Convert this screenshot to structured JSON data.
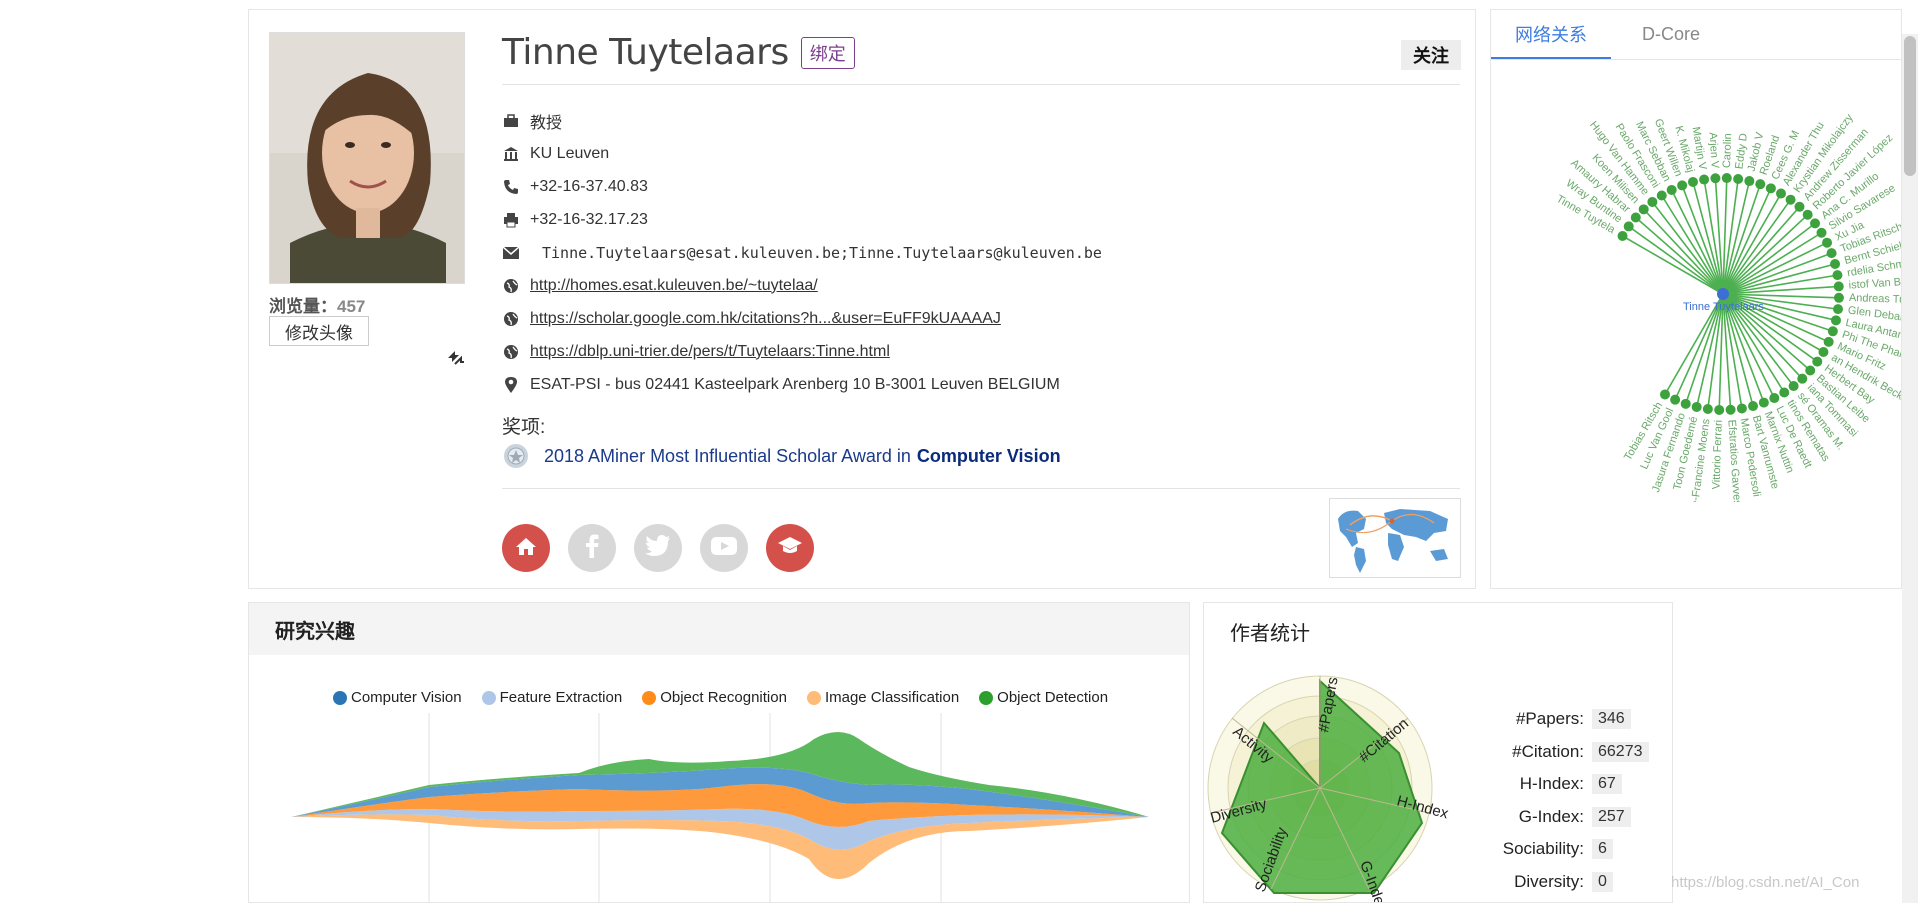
{
  "profile": {
    "name": "Tinne Tuytelaars",
    "bind_label": "绑定",
    "follow_label": "关注",
    "views_label": "浏览量：",
    "views_count": "457",
    "change_avatar_label": "修改头像",
    "position": "教授",
    "affiliation": "KU Leuven",
    "phone": "+32-16-37.40.83",
    "fax": "+32-16-32.17.23",
    "email": "Tinne.Tuytelaars@esat.kuleuven.be;Tinne.Tuytelaars@kuleuven.be",
    "homepage": "http://homes.esat.kuleuven.be/~tuytelaa/",
    "scholar": "https://scholar.google.com.hk/citations?h...&user=EuFF9kUAAAAJ",
    "dblp": "https://dblp.uni-trier.de/pers/t/Tuytelaars:Tinne.html",
    "address": "ESAT-PSI - bus 02441  Kasteelpark Arenberg 10  B-3001 Leuven  BELGIUM",
    "awards_label": "奖项:",
    "award_text": "2018 AMiner Most Influential Scholar Award in",
    "award_field": "Computer Vision"
  },
  "social_icons": [
    "home-icon",
    "facebook-icon",
    "twitter-icon",
    "youtube-icon",
    "graduation-cap-icon"
  ],
  "network": {
    "tabs": [
      "网络关系",
      "D-Core"
    ],
    "center": "Tinne Tuytelaars",
    "nodes": [
      "Tinne Tuytela",
      "Wray Buntine",
      "Amaury Habrar",
      "Koen Milisen",
      "Hugo Van Hamme",
      "Paolo Frasconi",
      "Marc Sebban",
      "Geert Willen",
      "K. Mikolaj",
      "Martijn V",
      "Arjen V",
      "Carolin",
      "Eddy D",
      "Jakob V",
      "Roeland",
      "Cees G. M",
      "Alexander Thu",
      "Krystian Mikolajczy",
      "Andrew Zisserman",
      "Roberto Javier López",
      "Ana C. Murillo",
      "Silvio Savarese",
      "Xu Jia",
      "Tobias Ritsch",
      "Bernt Schiele",
      "rdelia Schmid",
      "istof Van Beeck",
      "Andreas Turina",
      "Glen Debard",
      "Laura Antanas",
      "Phi The Pham",
      "Mario Fritz",
      "an Hendrik Becker",
      "Herbert Bay",
      "Bastian Leibe",
      "iana Tommasi",
      "sé Oramas M.",
      "tinos Rematas",
      "Luc De Raedt",
      "Marnix Nuttin",
      "Bart Vanrumste",
      "Marco Pedersoli",
      "Efstratios Gavves",
      "Vittorio Ferrari",
      "arie-Francine Moens",
      "Toon Goedemé",
      "Jasura Fernando",
      "Luc Van Gool",
      "Tobias Ritsch"
    ],
    "colors": {
      "line": "#4caf50",
      "node": "#3da23d",
      "label": "#6aa86a",
      "center": "#3b6fd4"
    }
  },
  "interests": {
    "title": "研究兴趣",
    "legend": [
      {
        "name": "Computer Vision",
        "color": "#2a75b3"
      },
      {
        "name": "Feature Extraction",
        "color": "#aec7e8"
      },
      {
        "name": "Object Recognition",
        "color": "#ff8c1a"
      },
      {
        "name": "Image Classification",
        "color": "#ffbb78"
      },
      {
        "name": "Object Detection",
        "color": "#2ca02c"
      }
    ]
  },
  "stats": {
    "title": "作者统计",
    "rows": [
      {
        "label": "#Papers:",
        "value": "346"
      },
      {
        "label": "#Citation:",
        "value": "66273"
      },
      {
        "label": "H-Index:",
        "value": "67"
      },
      {
        "label": "G-Index:",
        "value": "257"
      },
      {
        "label": "Sociability:",
        "value": "6"
      },
      {
        "label": "Diversity:",
        "value": "0"
      }
    ],
    "radar_axes": [
      "#Papers",
      "#Citation",
      "H-Index",
      "G-Index",
      "Sociability",
      "Diversity",
      "Activity"
    ]
  },
  "watermark": "https://blog.csdn.net/AI_Con"
}
